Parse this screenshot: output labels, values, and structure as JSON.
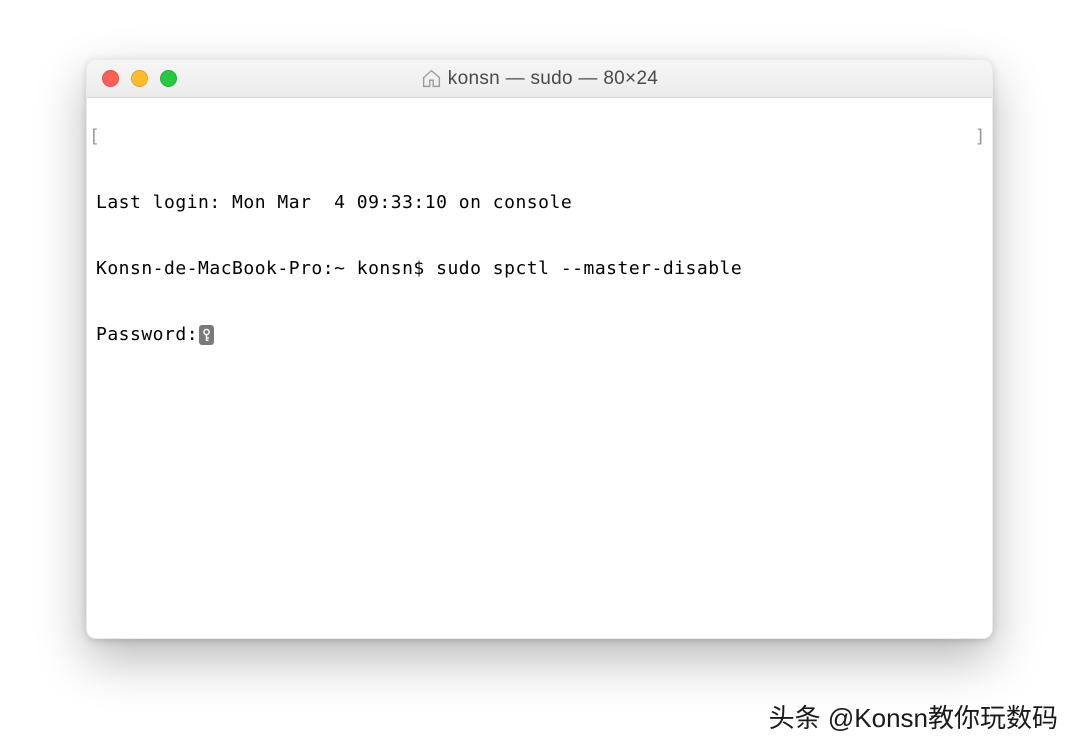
{
  "window": {
    "title": "konsn — sudo — 80×24"
  },
  "terminal": {
    "last_login": "Last login: Mon Mar  4 09:33:10 on console",
    "prompt_line": "Konsn-de-MacBook-Pro:~ konsn$ sudo spctl --master-disable",
    "password_label": "Password:"
  },
  "watermark": "头条 @Konsn教你玩数码"
}
